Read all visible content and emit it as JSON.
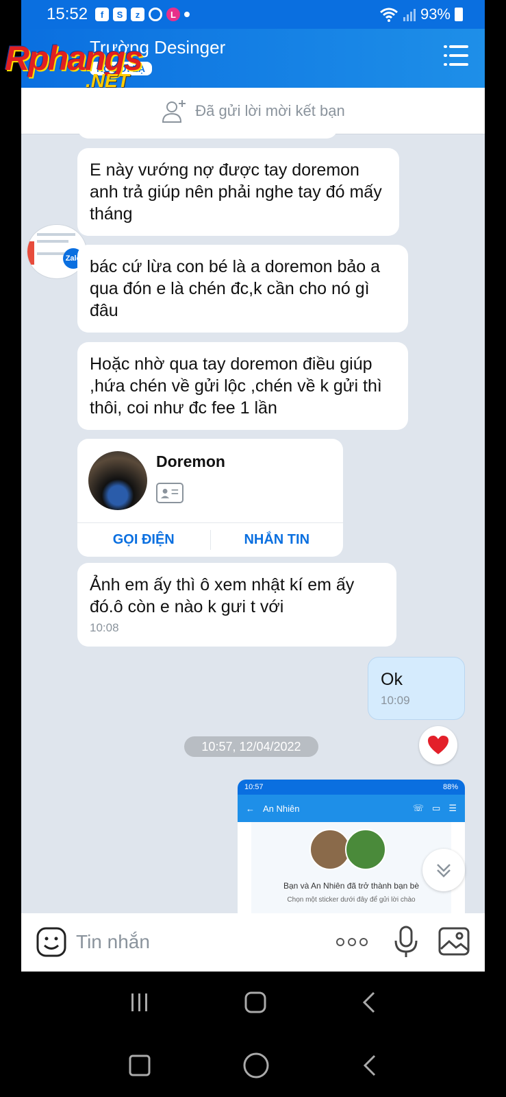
{
  "status_bar": {
    "time": "15:52",
    "battery": "93%"
  },
  "header": {
    "title": "Trường Desinger",
    "subtitle": "NGƯỜI LẠ"
  },
  "watermark": {
    "line1": "Rphangs",
    "line2": ".NET"
  },
  "friend_request": {
    "text": "Đã gửi lời mời kết bạn"
  },
  "messages": [
    {
      "text": "E này vướng nợ được tay doremon anh trả giúp nên phải nghe tay đó mấy tháng"
    },
    {
      "text": "bác cứ lừa con bé là a doremon bảo a qua đón e là chén đc,k cần cho nó gì đâu"
    },
    {
      "text": "Hoặc nhờ qua tay doremon điều giúp ,hứa chén về gửi lộc ,chén về k gửi thì thôi, coi như đc fee 1 lần"
    },
    {
      "text": "Ảnh em ấy thì ô xem nhật kí em ấy đó.ô còn e nào k gưi t với",
      "time": "10:08"
    },
    {
      "text": "Ok",
      "time": "10:09"
    }
  ],
  "contact_card": {
    "name": "Doremon",
    "call_label": "GỌI ĐIỆN",
    "message_label": "NHẮN TIN"
  },
  "date_divider": "10:57, 12/04/2022",
  "shared_image": {
    "status_time": "10:57",
    "status_battery": "88%",
    "header_title": "An Nhiên",
    "line1": "Bạn và An Nhiên đã trở thành bạn bè",
    "line2": "Chọn một sticker dưới đây để gửi lời chào"
  },
  "input": {
    "placeholder": "Tin nhắn"
  },
  "colors": {
    "brand": "#0a6fe0",
    "own_bubble": "#d5ebfd",
    "background": "#dfe5ed",
    "reaction": "#e3202a"
  }
}
